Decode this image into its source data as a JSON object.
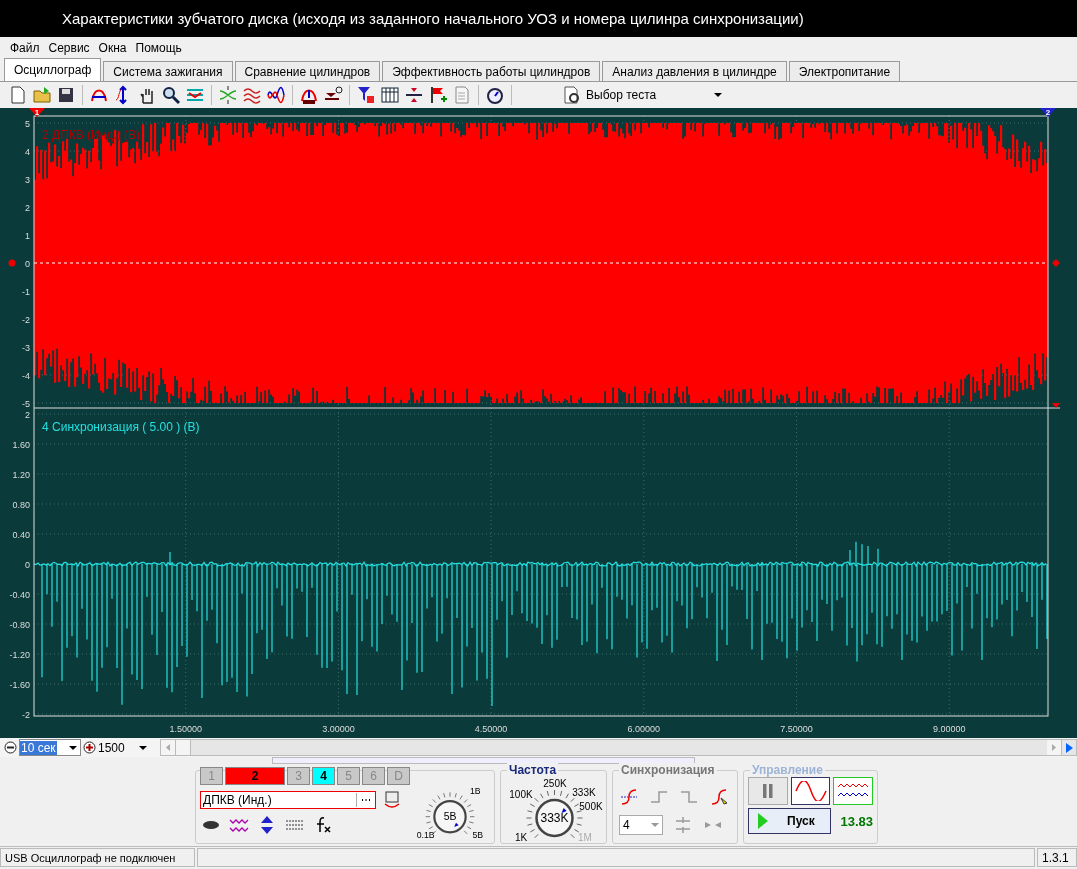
{
  "window": {
    "title": "Характеристики зубчатого диска (исходя из заданного начального УОЗ и номера цилинра синхронизации)"
  },
  "menu": [
    "Файл",
    "Сервис",
    "Окна",
    "Помощь"
  ],
  "tabs": [
    {
      "label": "Осциллограф",
      "selected": true
    },
    {
      "label": "Система зажигания",
      "selected": false
    },
    {
      "label": "Сравнение цилиндров",
      "selected": false
    },
    {
      "label": "Эффективность работы цилиндров",
      "selected": false
    },
    {
      "label": "Анализ давления в цилиндре",
      "selected": false
    },
    {
      "label": "Электропитание",
      "selected": false
    }
  ],
  "toolbar": {
    "test_select": "Выбор теста"
  },
  "scope": {
    "cursor_markers": [
      "1",
      "2"
    ],
    "plots": [
      {
        "label": "2 ДПКВ (Инд.) (В)",
        "yticks": [
          "5",
          "4",
          "3",
          "2",
          "1",
          "0",
          "-1",
          "-2",
          "-3",
          "-4",
          "-5"
        ]
      },
      {
        "label": "4 Синхронизация ( 5.00 ) (В)",
        "yticks": [
          "2",
          "1.60",
          "1.20",
          "0.80",
          "0.40",
          "0",
          "-0.40",
          "-0.80",
          "-1.20",
          "-1.60",
          "-2"
        ]
      }
    ],
    "xticks": [
      "1.50000",
      "3.00000",
      "4.50000",
      "6.00000",
      "7.50000",
      "9.00000"
    ]
  },
  "timebase": {
    "value": "10 сек",
    "points": "1500"
  },
  "channels": [
    {
      "label": "1",
      "on": false
    },
    {
      "label": "2",
      "on": true,
      "color": "#ff0000"
    },
    {
      "label": "3",
      "on": false
    },
    {
      "label": "4",
      "on": true,
      "color": "#00ffff"
    },
    {
      "label": "5",
      "on": false
    },
    {
      "label": "6",
      "on": false
    },
    {
      "label": "D",
      "on": false
    }
  ],
  "source_field": "ДПКВ (Инд.)",
  "voltage_knob": {
    "value": "5В",
    "labels": [
      {
        "text": "0.1В",
        "disabled": false
      },
      {
        "text": "1В",
        "disabled": false
      },
      {
        "text": "5В",
        "disabled": false
      }
    ]
  },
  "frequency": {
    "title": "Частота",
    "value": "333K",
    "labels": [
      {
        "text": "1K",
        "disabled": false
      },
      {
        "text": "100K",
        "disabled": false
      },
      {
        "text": "250K",
        "disabled": false
      },
      {
        "text": "333K",
        "disabled": false
      },
      {
        "text": "500K",
        "disabled": false
      },
      {
        "text": "1M",
        "disabled": true
      }
    ]
  },
  "sync": {
    "title": "Синхронизация",
    "channel": "4"
  },
  "control": {
    "title": "Управление",
    "start": "Пуск",
    "reading": "13.83"
  },
  "status_bar": {
    "message": "USB Осциллограф не подключен",
    "version": "1.3.1"
  }
}
